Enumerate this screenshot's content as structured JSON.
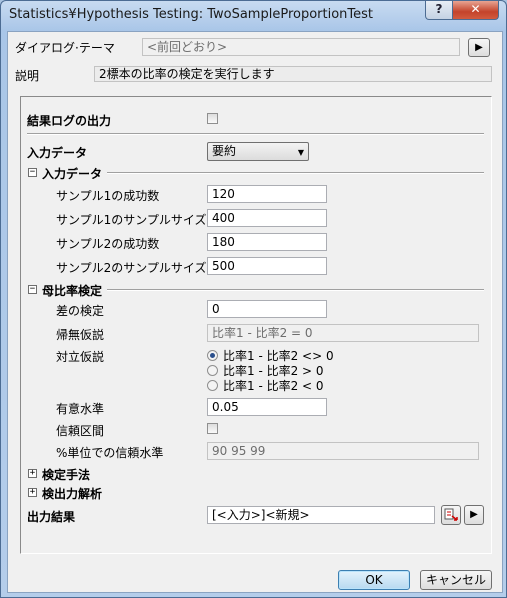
{
  "window": {
    "title": "Statistics¥Hypothesis Testing: TwoSampleProportionTest",
    "help": "?",
    "close": "✕"
  },
  "theme": {
    "label": "ダイアログ·テーマ",
    "value": "<前回どおり>",
    "arrow": "▶"
  },
  "description": {
    "label": "説明",
    "value": "2標本の比率の検定を実行します"
  },
  "result_log": {
    "label": "結果ログの出力",
    "checked": false
  },
  "input_data": {
    "label": "入力データ",
    "value": "要約",
    "arrow": "▼"
  },
  "input_section": {
    "label": "入力データ",
    "toggle": "−",
    "fields": [
      {
        "label": "サンプル1の成功数",
        "value": "120"
      },
      {
        "label": "サンプル1のサンプルサイズ",
        "value": "400"
      },
      {
        "label": "サンプル2の成功数",
        "value": "180"
      },
      {
        "label": "サンプル2のサンプルサイズ",
        "value": "500"
      }
    ]
  },
  "proportion_test": {
    "label": "母比率検定",
    "toggle": "−",
    "diff_label": "差の検定",
    "diff_value": "0",
    "null_label": "帰無仮説",
    "null_value": "比率1 - 比率2 = 0",
    "alt_label": "対立仮説",
    "alt_options": [
      "比率1 - 比率2 <> 0",
      "比率1 - 比率2 > 0",
      "比率1 - 比率2 < 0"
    ],
    "alt_selected": 0,
    "sig_label": "有意水準",
    "sig_value": "0.05",
    "ci_label": "信頼区間",
    "ci_level_label": "%単位での信頼水準",
    "ci_level_value": "90 95 99"
  },
  "method": {
    "label": "検定手法",
    "toggle": "+"
  },
  "analysis": {
    "label": "検出力解析",
    "toggle": "+"
  },
  "output": {
    "label": "出力結果",
    "value": "[<入力>]<新規>",
    "arrow": "▶"
  },
  "buttons": {
    "ok": "OK",
    "cancel": "キャンセル"
  }
}
